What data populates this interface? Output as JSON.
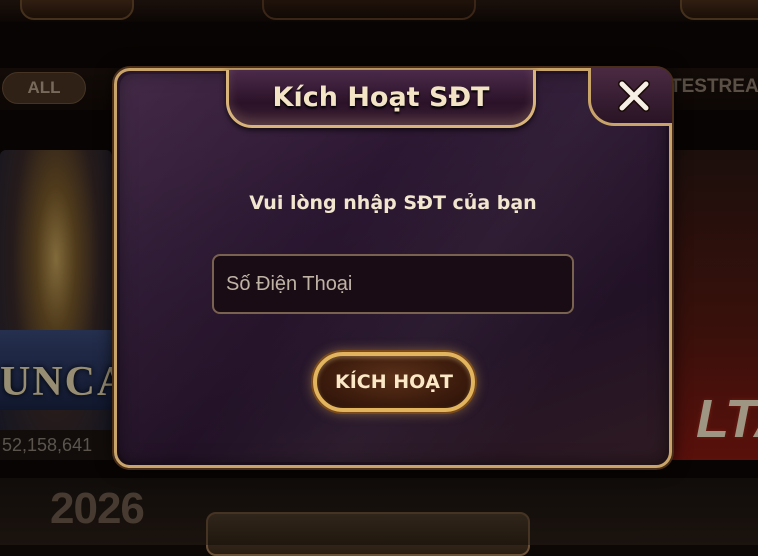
{
  "background": {
    "filter_all_label": "ALL",
    "livestream_label": "TESTREAM",
    "left_game_title": "UNCA",
    "left_game_jackpot": "52,158,641",
    "right_game_title": "LTA",
    "bottom_banner_text": "2026"
  },
  "dialog": {
    "title": "Kích Hoạt SĐT",
    "prompt": "Vui lòng nhập SĐT của bạn",
    "phone_input": {
      "value": "",
      "placeholder": "Số Điện Thoại"
    },
    "activate_button_label": "KÍCH HOẠT",
    "close_icon": "close-icon"
  },
  "colors": {
    "frame_gold": "#c9a46a",
    "dialog_purple": "#2a1630",
    "text_cream": "#f4e4c6"
  }
}
